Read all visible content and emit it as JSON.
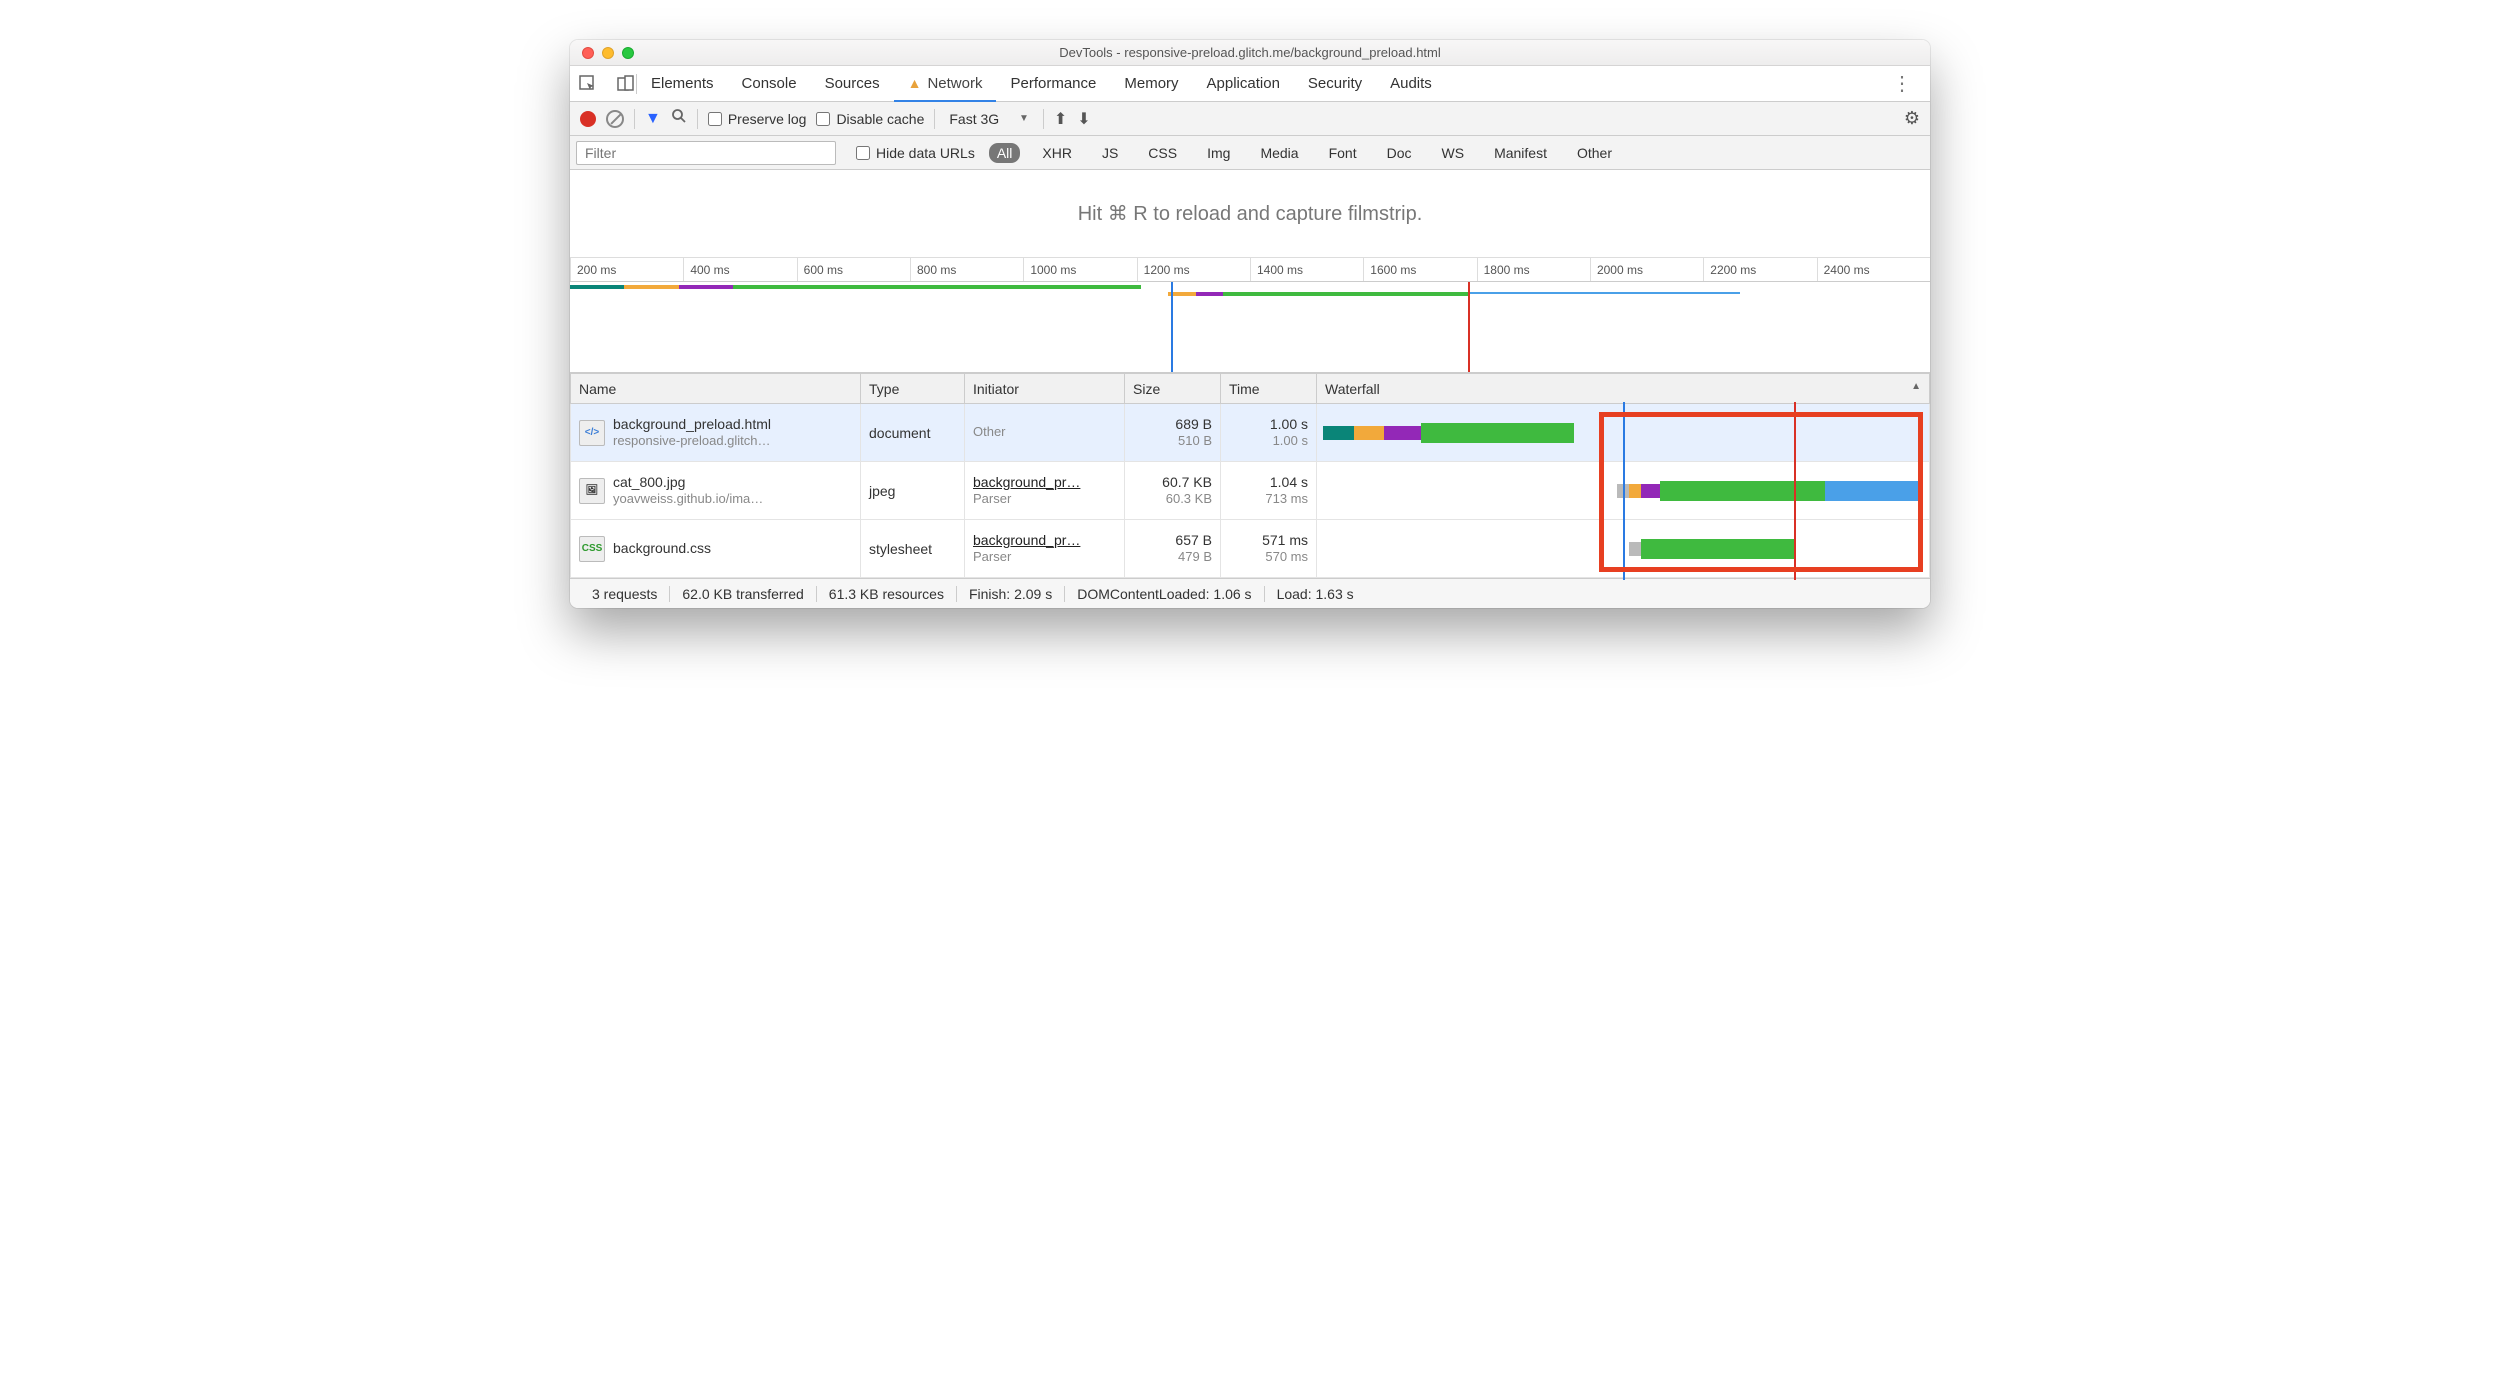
{
  "window": {
    "title": "DevTools - responsive-preload.glitch.me/background_preload.html"
  },
  "main_tabs": {
    "elements": "Elements",
    "console": "Console",
    "sources": "Sources",
    "network": "Network",
    "performance": "Performance",
    "memory": "Memory",
    "application": "Application",
    "security": "Security",
    "audits": "Audits"
  },
  "toolbar": {
    "preserve_log": "Preserve log",
    "disable_cache": "Disable cache",
    "throttling": "Fast 3G"
  },
  "filterbar": {
    "placeholder": "Filter",
    "hide_data_urls": "Hide data URLs",
    "types": {
      "all": "All",
      "xhr": "XHR",
      "js": "JS",
      "css": "CSS",
      "img": "Img",
      "media": "Media",
      "font": "Font",
      "doc": "Doc",
      "ws": "WS",
      "manifest": "Manifest",
      "other": "Other"
    }
  },
  "filmstrip_hint": "Hit ⌘ R to reload and capture filmstrip.",
  "ruler_ticks": [
    "200 ms",
    "400 ms",
    "600 ms",
    "800 ms",
    "1000 ms",
    "1200 ms",
    "1400 ms",
    "1600 ms",
    "1800 ms",
    "2000 ms",
    "2200 ms",
    "2400 ms"
  ],
  "columns": {
    "name": "Name",
    "type": "Type",
    "initiator": "Initiator",
    "size": "Size",
    "time": "Time",
    "waterfall": "Waterfall"
  },
  "rows": [
    {
      "name": "background_preload.html",
      "sub": "responsive-preload.glitch…",
      "type": "document",
      "initiator": "Other",
      "initiator_sub": "",
      "size": "689 B",
      "size_sub": "510 B",
      "time": "1.00 s",
      "time_sub": "1.00 s"
    },
    {
      "name": "cat_800.jpg",
      "sub": "yoavweiss.github.io/ima…",
      "type": "jpeg",
      "initiator": "background_pr…",
      "initiator_sub": "Parser",
      "size": "60.7 KB",
      "size_sub": "60.3 KB",
      "time": "1.04 s",
      "time_sub": "713 ms"
    },
    {
      "name": "background.css",
      "sub": "",
      "type": "stylesheet",
      "initiator": "background_pr…",
      "initiator_sub": "Parser",
      "size": "657 B",
      "size_sub": "479 B",
      "time": "571 ms",
      "time_sub": "570 ms"
    }
  ],
  "status": {
    "requests": "3 requests",
    "transferred": "62.0 KB transferred",
    "resources": "61.3 KB resources",
    "finish": "Finish: 2.09 s",
    "dcl": "DOMContentLoaded: 1.06 s",
    "load": "Load: 1.63 s"
  },
  "icons": {
    "html": "</>",
    "css": "CSS"
  }
}
